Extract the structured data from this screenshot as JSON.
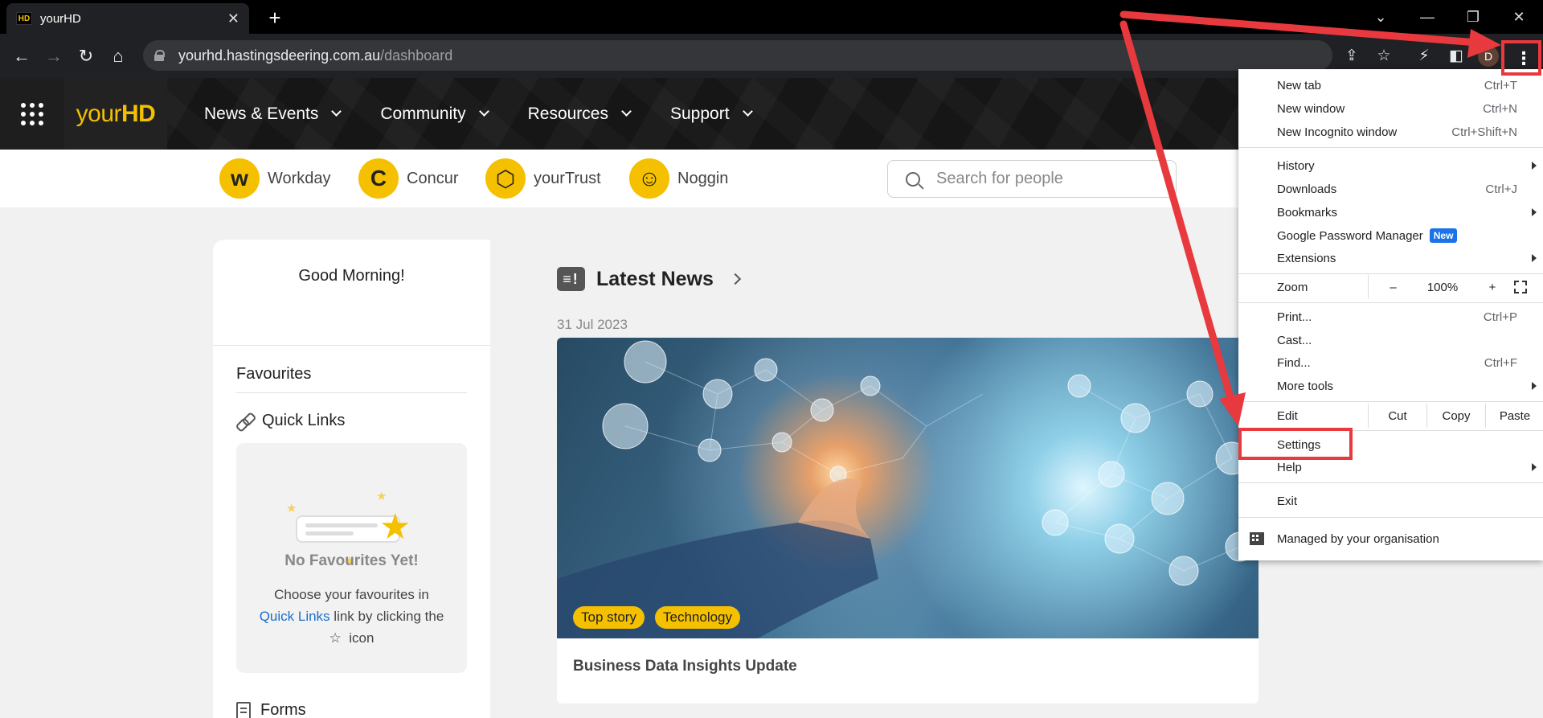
{
  "browser": {
    "tab_title": "yourHD",
    "tab_favicon_text": "HD",
    "url_host": "yourhd.hastingsdeering.com.au",
    "url_path": "/dashboard",
    "profile_initial": "D"
  },
  "site": {
    "logo_prefix": "your",
    "logo_suffix": "HD",
    "nav": [
      {
        "label": "News & Events"
      },
      {
        "label": "Community"
      },
      {
        "label": "Resources"
      },
      {
        "label": "Support"
      }
    ],
    "apps": [
      {
        "label": "Workday"
      },
      {
        "label": "Concur"
      },
      {
        "label": "yourTrust"
      },
      {
        "label": "Noggin"
      }
    ],
    "search_placeholder": "Search for people"
  },
  "left_panel": {
    "greeting": "Good Morning!",
    "favourites_title": "Favourites",
    "quick_links_title": "Quick Links",
    "no_favourites": "No Favourites Yet!",
    "desc_part1": "Choose your favourites in",
    "desc_link": "Quick Links",
    "desc_part2": "link by clicking the",
    "desc_part3": "icon",
    "forms_title": "Forms"
  },
  "news": {
    "section_title": "Latest News",
    "date": "31 Jul 2023",
    "tags": [
      "Top story",
      "Technology"
    ],
    "headline": "Business Data Insights Update"
  },
  "chrome_menu": {
    "new_tab": "New tab",
    "new_tab_sc": "Ctrl+T",
    "new_window": "New window",
    "new_window_sc": "Ctrl+N",
    "incognito": "New Incognito window",
    "incognito_sc": "Ctrl+Shift+N",
    "history": "History",
    "downloads": "Downloads",
    "downloads_sc": "Ctrl+J",
    "bookmarks": "Bookmarks",
    "password_manager": "Google Password Manager",
    "new_badge": "New",
    "extensions": "Extensions",
    "zoom": "Zoom",
    "zoom_minus": "–",
    "zoom_value": "100%",
    "zoom_plus": "+",
    "print": "Print...",
    "print_sc": "Ctrl+P",
    "cast": "Cast...",
    "find": "Find...",
    "find_sc": "Ctrl+F",
    "more_tools": "More tools",
    "edit": "Edit",
    "cut": "Cut",
    "copy": "Copy",
    "paste": "Paste",
    "settings": "Settings",
    "help": "Help",
    "exit": "Exit",
    "managed": "Managed by your organisation"
  },
  "annotation_color": "#e8393e",
  "accent_color": "#f5c000"
}
